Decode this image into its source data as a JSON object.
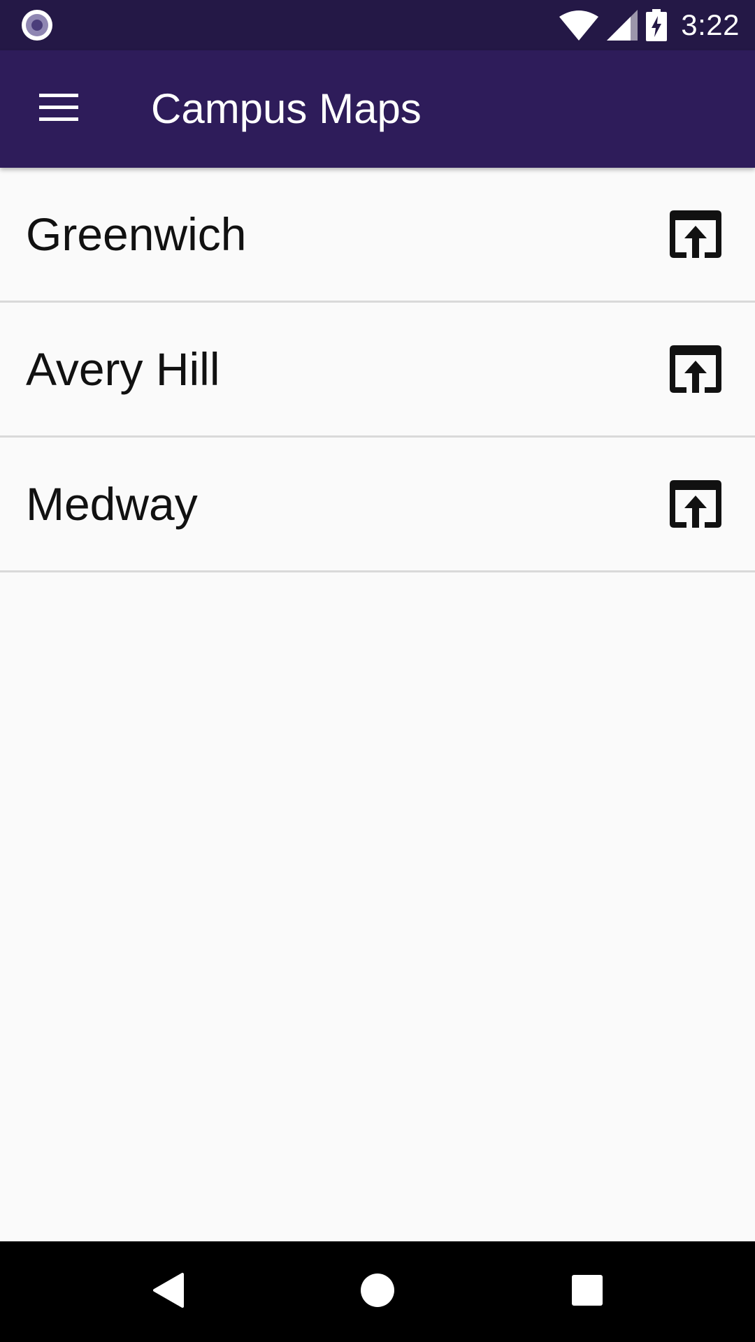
{
  "status_bar": {
    "time": "3:22",
    "icons": [
      "notification-dot-icon",
      "wifi-icon",
      "cellular-signal-icon",
      "battery-charging-icon"
    ]
  },
  "app_bar": {
    "menu_icon": "hamburger-menu-icon",
    "title": "Campus Maps"
  },
  "campuses": [
    {
      "label": "Greenwich",
      "icon": "open-in-new-icon"
    },
    {
      "label": "Avery Hill",
      "icon": "open-in-new-icon"
    },
    {
      "label": "Medway",
      "icon": "open-in-new-icon"
    }
  ],
  "nav_bar": {
    "buttons": [
      "back-icon",
      "home-icon",
      "recents-icon"
    ]
  },
  "colors": {
    "status_bar": "#241846",
    "app_bar": "#2e1c5a",
    "background": "#fafafa",
    "divider": "#d9d9d9",
    "nav_bar": "#000000"
  }
}
